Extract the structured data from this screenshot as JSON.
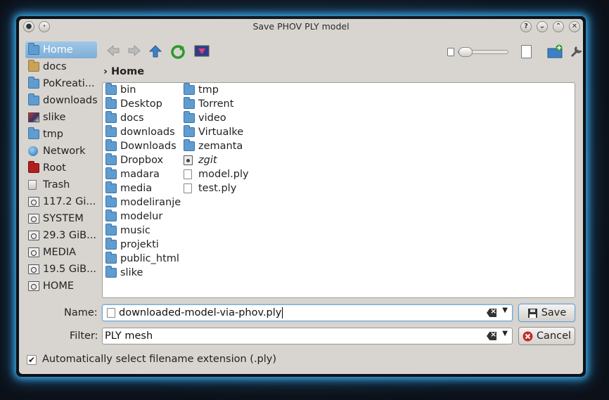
{
  "window": {
    "title": "Save PHOV PLY model"
  },
  "titlebar": {
    "left_buttons": [
      "menu-icon",
      "sticky-icon"
    ],
    "right_buttons": [
      "?",
      "⌄",
      "⌃",
      "✕"
    ]
  },
  "places": [
    {
      "label": "Home",
      "icon": "folder-home-icon",
      "selected": true
    },
    {
      "label": "docs",
      "icon": "folder-icon"
    },
    {
      "label": "PoKreati...",
      "icon": "folder-icon"
    },
    {
      "label": "downloads",
      "icon": "folder-downloads-icon"
    },
    {
      "label": "slike",
      "icon": "folder-images-icon"
    },
    {
      "label": "tmp",
      "icon": "folder-icon"
    },
    {
      "label": "Network",
      "icon": "network-icon"
    },
    {
      "label": "Root",
      "icon": "folder-red-icon"
    },
    {
      "label": "Trash",
      "icon": "trash-icon"
    },
    {
      "label": "117.2 Gi...",
      "icon": "drive-icon"
    },
    {
      "label": "SYSTEM",
      "icon": "drive-icon"
    },
    {
      "label": "29.3 GiB...",
      "icon": "drive-icon"
    },
    {
      "label": "MEDIA",
      "icon": "drive-icon"
    },
    {
      "label": "19.5 GiB...",
      "icon": "drive-icon"
    },
    {
      "label": "HOME",
      "icon": "drive-icon"
    }
  ],
  "breadcrumb": {
    "separator": "›",
    "current": "Home"
  },
  "files_col1": [
    "bin",
    "Desktop",
    "docs",
    "downloads",
    "Downloads",
    "Dropbox",
    "madara",
    "media",
    "modeliranje",
    "modelur",
    "music",
    "projekti",
    "public_html",
    "slike"
  ],
  "files_col2": [
    {
      "name": "tmp",
      "type": "folder"
    },
    {
      "name": "Torrent",
      "type": "folder"
    },
    {
      "name": "video",
      "type": "folder"
    },
    {
      "name": "Virtualke",
      "type": "folder"
    },
    {
      "name": "zemanta",
      "type": "folder"
    },
    {
      "name": "zgit",
      "type": "link"
    },
    {
      "name": "model.ply",
      "type": "file"
    },
    {
      "name": "test.ply",
      "type": "file"
    }
  ],
  "form": {
    "name_label": "Name:",
    "name_value": "downloaded-model-via-phov.ply",
    "filter_label": "Filter:",
    "filter_value": "PLY mesh",
    "save_label": "Save",
    "cancel_label": "Cancel",
    "auto_ext_label": "Automatically select filename extension (.ply)",
    "auto_ext_checked": true
  },
  "colors": {
    "accent": "#5f9cd0",
    "selection": "#8cb9e0",
    "glow": "#3aa3e0"
  }
}
